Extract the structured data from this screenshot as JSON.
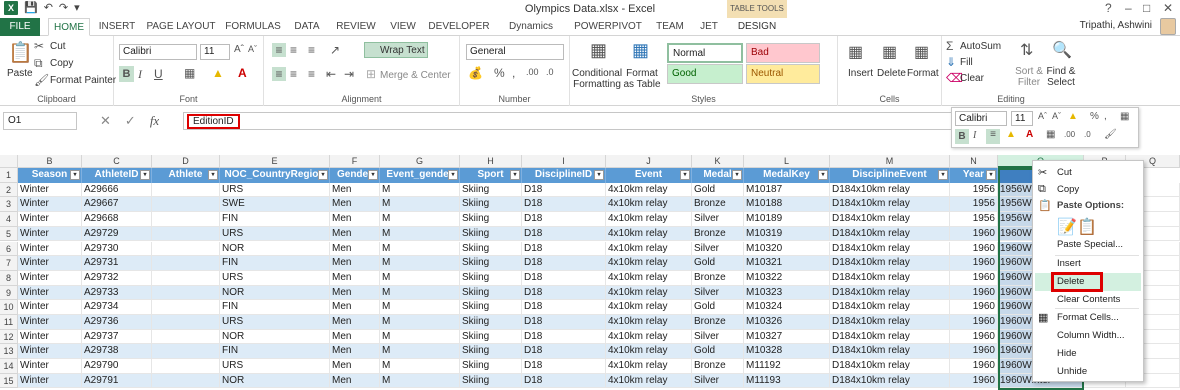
{
  "window": {
    "title": "Olympics Data.xlsx - Excel",
    "table_tools": "TABLE TOOLS",
    "user": "Tripathi, Ashwini"
  },
  "tabs": [
    "FILE",
    "HOME",
    "INSERT",
    "PAGE LAYOUT",
    "FORMULAS",
    "DATA",
    "REVIEW",
    "VIEW",
    "DEVELOPER",
    "Dynamics NAV",
    "POWERPIVOT",
    "TEAM",
    "JET",
    "DESIGN"
  ],
  "ribbon": {
    "clipboard": {
      "paste": "Paste",
      "cut": "Cut",
      "copy": "Copy",
      "format_painter": "Format Painter",
      "label": "Clipboard"
    },
    "font": {
      "name": "Calibri",
      "size": "11",
      "label": "Font"
    },
    "alignment": {
      "wrap": "Wrap Text",
      "merge": "Merge & Center",
      "label": "Alignment"
    },
    "number": {
      "format": "General",
      "label": "Number"
    },
    "styles": {
      "conditional": "Conditional Formatting",
      "format_table": "Format as Table",
      "normal": "Normal",
      "bad": "Bad",
      "good": "Good",
      "neutral": "Neutral",
      "label": "Styles"
    },
    "cells": {
      "insert": "Insert",
      "delete": "Delete",
      "format": "Format",
      "label": "Cells"
    },
    "editing": {
      "autosum": "AutoSum",
      "fill": "Fill",
      "clear": "Clear",
      "sort": "Sort & Filter",
      "find": "Find & Select",
      "label": "Editing"
    }
  },
  "formula_bar": {
    "name_box": "O1",
    "value": "EditionID"
  },
  "mini_toolbar": {
    "font": "Calibri",
    "size": "11"
  },
  "grid": {
    "columns": [
      "B",
      "C",
      "D",
      "E",
      "F",
      "G",
      "H",
      "I",
      "J",
      "K",
      "L",
      "M",
      "N",
      "O",
      "P",
      "Q"
    ],
    "headers": [
      "Season",
      "AthleteID",
      "Athlete",
      "NOC_CountryRegion",
      "Gender",
      "Event_gender",
      "Sport",
      "DisciplineID",
      "Event",
      "Medal",
      "MedalKey",
      "DisciplineEvent",
      "Year",
      "Edi"
    ],
    "row_numbers": [
      "1",
      "2",
      "3",
      "4",
      "5",
      "6",
      "7",
      "8",
      "9",
      "10",
      "11",
      "12",
      "13",
      "14",
      "15"
    ],
    "rows": [
      [
        "Winter",
        "A29666",
        "",
        "URS",
        "Men",
        "M",
        "Skiing",
        "D18",
        "4x10km relay",
        "Gold",
        "M10187",
        "D184x10km relay",
        "1956",
        "1956Wi"
      ],
      [
        "Winter",
        "A29667",
        "",
        "SWE",
        "Men",
        "M",
        "Skiing",
        "D18",
        "4x10km relay",
        "Bronze",
        "M10188",
        "D184x10km relay",
        "1956",
        "1956Wi"
      ],
      [
        "Winter",
        "A29668",
        "",
        "FIN",
        "Men",
        "M",
        "Skiing",
        "D18",
        "4x10km relay",
        "Silver",
        "M10189",
        "D184x10km relay",
        "1956",
        "1956Wi"
      ],
      [
        "Winter",
        "A29729",
        "",
        "URS",
        "Men",
        "M",
        "Skiing",
        "D18",
        "4x10km relay",
        "Bronze",
        "M10319",
        "D184x10km relay",
        "1960",
        "1960Wi"
      ],
      [
        "Winter",
        "A29730",
        "",
        "NOR",
        "Men",
        "M",
        "Skiing",
        "D18",
        "4x10km relay",
        "Silver",
        "M10320",
        "D184x10km relay",
        "1960",
        "1960Wi"
      ],
      [
        "Winter",
        "A29731",
        "",
        "FIN",
        "Men",
        "M",
        "Skiing",
        "D18",
        "4x10km relay",
        "Gold",
        "M10321",
        "D184x10km relay",
        "1960",
        "1960Wi"
      ],
      [
        "Winter",
        "A29732",
        "",
        "URS",
        "Men",
        "M",
        "Skiing",
        "D18",
        "4x10km relay",
        "Bronze",
        "M10322",
        "D184x10km relay",
        "1960",
        "1960Wi"
      ],
      [
        "Winter",
        "A29733",
        "",
        "NOR",
        "Men",
        "M",
        "Skiing",
        "D18",
        "4x10km relay",
        "Silver",
        "M10323",
        "D184x10km relay",
        "1960",
        "1960Wi"
      ],
      [
        "Winter",
        "A29734",
        "",
        "FIN",
        "Men",
        "M",
        "Skiing",
        "D18",
        "4x10km relay",
        "Gold",
        "M10324",
        "D184x10km relay",
        "1960",
        "1960Wi"
      ],
      [
        "Winter",
        "A29736",
        "",
        "URS",
        "Men",
        "M",
        "Skiing",
        "D18",
        "4x10km relay",
        "Bronze",
        "M10326",
        "D184x10km relay",
        "1960",
        "1960Wi"
      ],
      [
        "Winter",
        "A29737",
        "",
        "NOR",
        "Men",
        "M",
        "Skiing",
        "D18",
        "4x10km relay",
        "Silver",
        "M10327",
        "D184x10km relay",
        "1960",
        "1960Wi"
      ],
      [
        "Winter",
        "A29738",
        "",
        "FIN",
        "Men",
        "M",
        "Skiing",
        "D18",
        "4x10km relay",
        "Gold",
        "M10328",
        "D184x10km relay",
        "1960",
        "1960Wi"
      ],
      [
        "Winter",
        "A29790",
        "",
        "URS",
        "Men",
        "M",
        "Skiing",
        "D18",
        "4x10km relay",
        "Bronze",
        "M11192",
        "D184x10km relay",
        "1960",
        "1960Wi"
      ],
      [
        "Winter",
        "A29791",
        "",
        "NOR",
        "Men",
        "M",
        "Skiing",
        "D18",
        "4x10km relay",
        "Silver",
        "M11193",
        "D184x10km relay",
        "1960",
        "1960Winter"
      ]
    ]
  },
  "context_menu": {
    "items": [
      "Cut",
      "Copy",
      "Paste Options:",
      "Paste Special...",
      "Insert",
      "Delete",
      "Clear Contents",
      "Format Cells...",
      "Column Width...",
      "Hide",
      "Unhide"
    ]
  }
}
